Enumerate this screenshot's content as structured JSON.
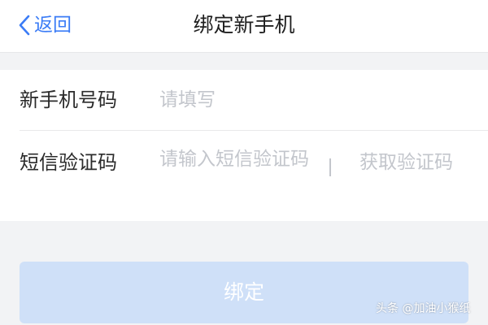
{
  "colors": {
    "accent": "#3b7cf6",
    "page_bg": "#f2f3f5",
    "button_disabled_bg": "#cfe0f8"
  },
  "header": {
    "back_label": "返回",
    "back_icon": "chevron-left-icon",
    "title": "绑定新手机"
  },
  "form": {
    "phone": {
      "label": "新手机号码",
      "placeholder": "请填写",
      "value": ""
    },
    "code": {
      "label": "短信验证码",
      "placeholder": "请输入短信验证码",
      "value": "",
      "get_code_label": "获取验证码"
    }
  },
  "submit": {
    "label": "绑定"
  },
  "watermark": {
    "text": "头条 @加油小猴纸"
  }
}
